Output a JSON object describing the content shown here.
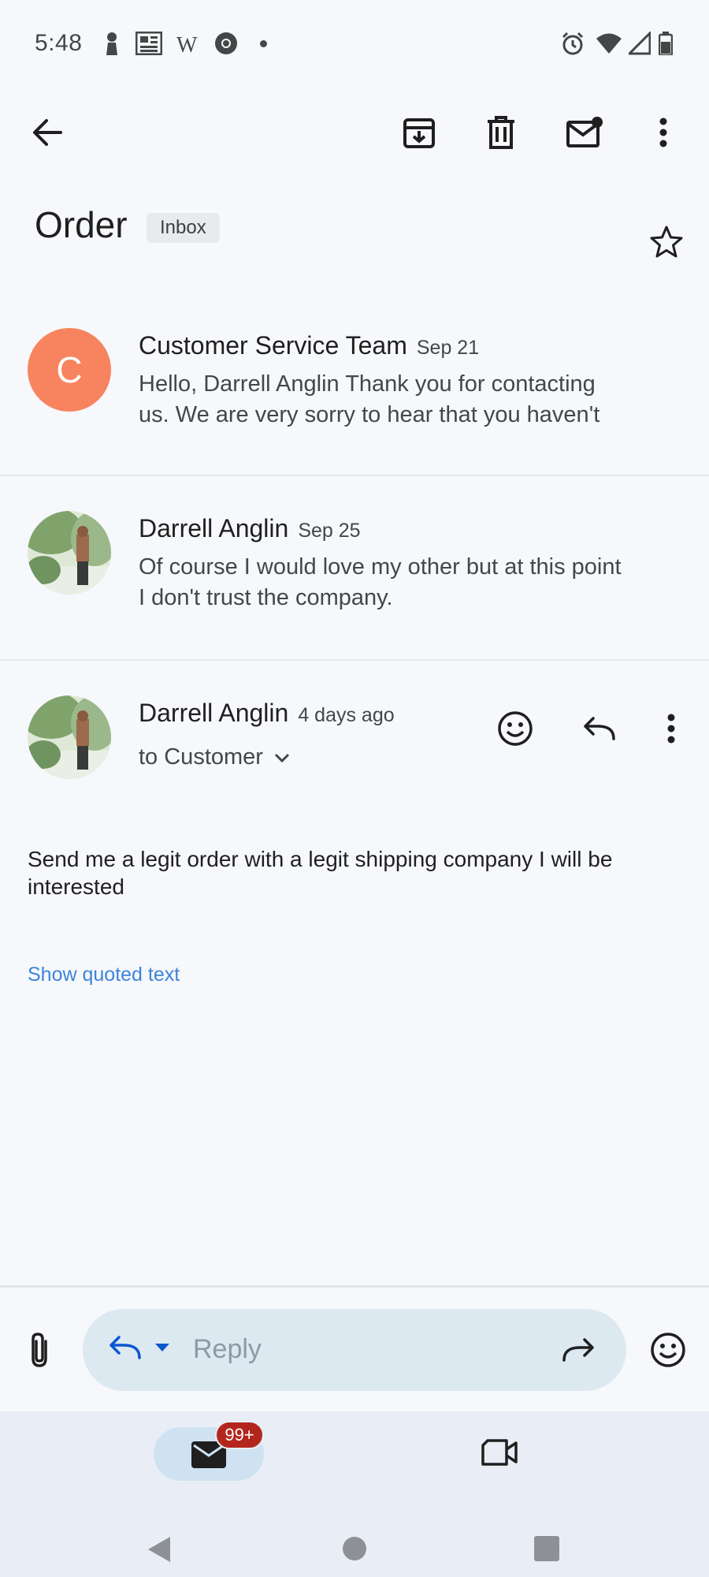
{
  "status_bar": {
    "time": "5:48",
    "left_icons": [
      "person-icon",
      "newspaper-icon",
      "wikipedia-icon",
      "chrome-icon",
      "dot-icon"
    ],
    "right_icons": [
      "alarm-icon",
      "wifi-icon",
      "signal-icon",
      "battery-icon"
    ]
  },
  "toolbar": {
    "icons": [
      "back-arrow-icon",
      "archive-icon",
      "delete-icon",
      "mark-unread-icon",
      "more-vert-icon"
    ]
  },
  "thread": {
    "subject": "Order",
    "label": "Inbox",
    "starred": false
  },
  "messages": [
    {
      "sender": "Customer Service Team",
      "date": "Sep 21",
      "avatar_letter": "C",
      "avatar_color": "#f7845e",
      "snippet_line1": "Hello, Darrell Anglin Thank you for contacting",
      "snippet_line2": "us. We are very sorry to hear that you haven't"
    },
    {
      "sender": "Darrell Anglin",
      "date": "Sep 25",
      "avatar_type": "photo",
      "snippet_line1": "Of course I would love my other but at this point",
      "snippet_line2": "I don't trust the company."
    },
    {
      "sender": "Darrell Anglin",
      "date": "4 days ago",
      "avatar_type": "photo",
      "recipient": "to Customer",
      "body_line1": "Send me a legit order with a legit shipping company I will be",
      "body_line2": "interested",
      "quoted_link": "Show quoted text"
    }
  ],
  "reply_bar": {
    "placeholder": "Reply"
  },
  "bottom_nav": {
    "mail_badge": "99+",
    "items": [
      "mail-icon",
      "meet-video-icon"
    ]
  },
  "colors": {
    "background": "#f6f8fc",
    "accent": "#0b57d0",
    "link": "#3d84d8",
    "badge": "#b3261e"
  }
}
